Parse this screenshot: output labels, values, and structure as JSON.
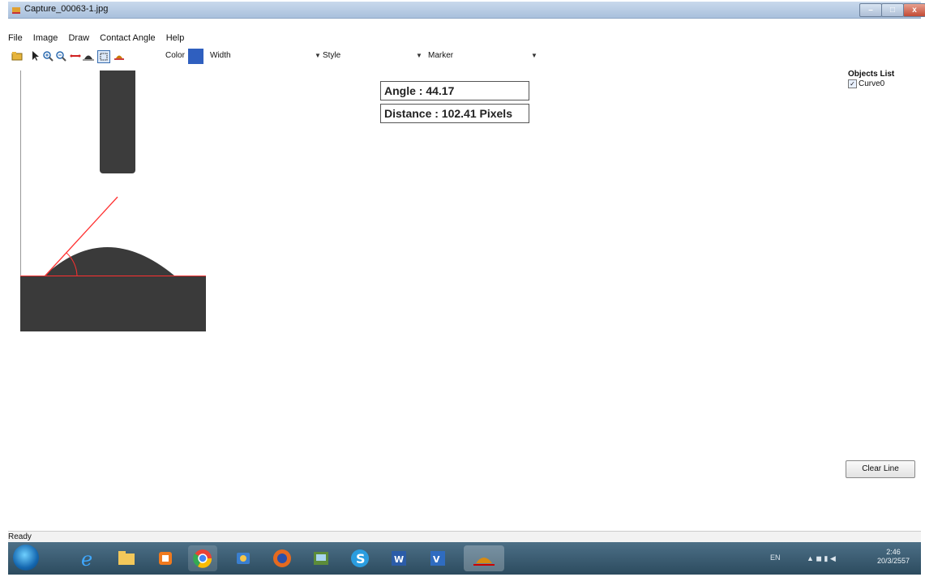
{
  "window": {
    "title": "Capture_00063-1.jpg",
    "buttons": {
      "minimize": "–",
      "maximize": "□",
      "close": "x"
    }
  },
  "menu": {
    "items": [
      "File",
      "Image",
      "Draw",
      "Contact Angle",
      "Help"
    ]
  },
  "toolbar": {
    "icons": [
      "open-icon",
      "pointer-icon",
      "zoom-in-icon",
      "zoom-out-icon",
      "line-icon",
      "baseline-icon",
      "select-icon",
      "contact-angle-icon"
    ],
    "color_label": "Color",
    "color_value": "#2f5fbf",
    "width_label": "Width",
    "style_label": "Style",
    "marker_label": "Marker"
  },
  "measurements": {
    "angle": "Angle : 44.17",
    "distance": "Distance : 102.41 Pixels"
  },
  "objects_list": {
    "label": "Objects List",
    "items": [
      {
        "name": "Curve0",
        "checked": true
      }
    ]
  },
  "actions": {
    "clear_line": "Clear Line"
  },
  "status": {
    "text": "Ready"
  },
  "taskbar": {
    "apps": [
      "ie-icon",
      "explorer-icon",
      "media-player-icon",
      "chrome-icon",
      "paint-icon",
      "firefox-icon",
      "photos-icon",
      "skype-icon",
      "word-icon",
      "visio-icon",
      "contact-angle-app-icon"
    ],
    "tray_lang": "EN",
    "time": "2:46",
    "date": "20/3/2557"
  },
  "colors": {
    "accent_line": "#ff3030",
    "drop": "#3a3a3a"
  }
}
